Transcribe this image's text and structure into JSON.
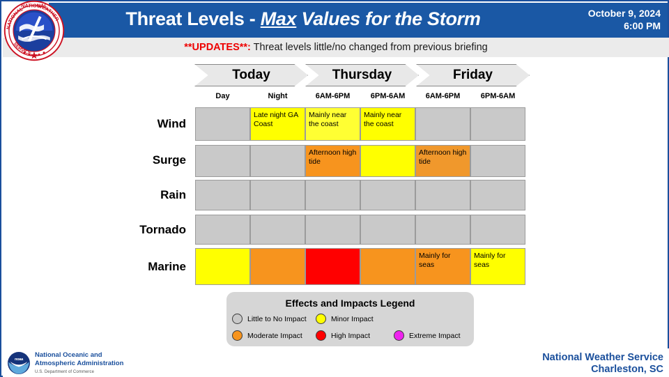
{
  "header": {
    "title_prefix": "Threat Levels - ",
    "title_emph": "Max",
    "title_rest": " Values for the Storm",
    "date": "October 9, 2024",
    "time": "6:00 PM",
    "seal_icon": "nws-seal-icon",
    "bar_color": "#1a58a5"
  },
  "updates": {
    "tag": "**UPDATES**:",
    "text": " Threat levels little/no changed from previous briefing",
    "tag_color": "#ee0000"
  },
  "table": {
    "days": [
      {
        "label": "Today",
        "periods": [
          "Day",
          "Night"
        ]
      },
      {
        "label": "Thursday",
        "periods": [
          "6AM-6PM",
          "6PM-6AM"
        ]
      },
      {
        "label": "Friday",
        "periods": [
          "6AM-6PM",
          "6PM-6AM"
        ]
      }
    ],
    "rows": [
      {
        "label": "Wind",
        "cells": [
          {
            "level": "none",
            "color": "#c9c9c9",
            "text": ""
          },
          {
            "level": "minor",
            "color": "#ffff00",
            "text": "Late night GA Coast"
          },
          {
            "level": "minor",
            "color": "#ffff33",
            "text": "Mainly near the coast"
          },
          {
            "level": "minor",
            "color": "#ffff00",
            "text": "Mainly near the coast"
          },
          {
            "level": "none",
            "color": "#c9c9c9",
            "text": ""
          },
          {
            "level": "none",
            "color": "#c9c9c9",
            "text": ""
          }
        ]
      },
      {
        "label": "Surge",
        "cells": [
          {
            "level": "none",
            "color": "#c9c9c9",
            "text": ""
          },
          {
            "level": "none",
            "color": "#c9c9c9",
            "text": ""
          },
          {
            "level": "moderate",
            "color": "#f7941e",
            "text": "Afternoon high tide"
          },
          {
            "level": "minor",
            "color": "#ffff00",
            "text": ""
          },
          {
            "level": "moderate",
            "color": "#f0982c",
            "text": "Afternoon high tide"
          },
          {
            "level": "none",
            "color": "#c9c9c9",
            "text": ""
          }
        ]
      },
      {
        "label": "Rain",
        "cells": [
          {
            "level": "none",
            "color": "#c9c9c9",
            "text": ""
          },
          {
            "level": "none",
            "color": "#c9c9c9",
            "text": ""
          },
          {
            "level": "none",
            "color": "#c9c9c9",
            "text": ""
          },
          {
            "level": "none",
            "color": "#c9c9c9",
            "text": ""
          },
          {
            "level": "none",
            "color": "#c9c9c9",
            "text": ""
          },
          {
            "level": "none",
            "color": "#c9c9c9",
            "text": ""
          }
        ]
      },
      {
        "label": "Tornado",
        "cells": [
          {
            "level": "none",
            "color": "#c9c9c9",
            "text": ""
          },
          {
            "level": "none",
            "color": "#c9c9c9",
            "text": ""
          },
          {
            "level": "none",
            "color": "#c9c9c9",
            "text": ""
          },
          {
            "level": "none",
            "color": "#c9c9c9",
            "text": ""
          },
          {
            "level": "none",
            "color": "#c9c9c9",
            "text": ""
          },
          {
            "level": "none",
            "color": "#c9c9c9",
            "text": ""
          }
        ]
      },
      {
        "label": "Marine",
        "cells": [
          {
            "level": "minor",
            "color": "#ffff00",
            "text": ""
          },
          {
            "level": "moderate",
            "color": "#f7941e",
            "text": ""
          },
          {
            "level": "high",
            "color": "#ff0000",
            "text": ""
          },
          {
            "level": "moderate",
            "color": "#f7941e",
            "text": ""
          },
          {
            "level": "moderate",
            "color": "#f7941e",
            "text": "Mainly for seas"
          },
          {
            "level": "minor",
            "color": "#ffff00",
            "text": "Mainly for seas"
          }
        ]
      }
    ]
  },
  "legend": {
    "title": "Effects and Impacts Legend",
    "items": [
      {
        "label": "Little to No Impact",
        "color": "#c9c9c9"
      },
      {
        "label": "Minor Impact",
        "color": "#ffff00"
      },
      {
        "label": "Moderate Impact",
        "color": "#f7941e"
      },
      {
        "label": "High Impact",
        "color": "#ff0000"
      },
      {
        "label": "Extreme Impact",
        "color": "#ee22ee"
      }
    ]
  },
  "footer": {
    "noaa_logo_icon": "noaa-logo-icon",
    "agency_line1": "National Oceanic and",
    "agency_line2": "Atmospheric Administration",
    "agency_sub": "U.S. Department of Commerce",
    "office_line1": "National Weather Service",
    "office_line2": "Charleston, SC"
  }
}
